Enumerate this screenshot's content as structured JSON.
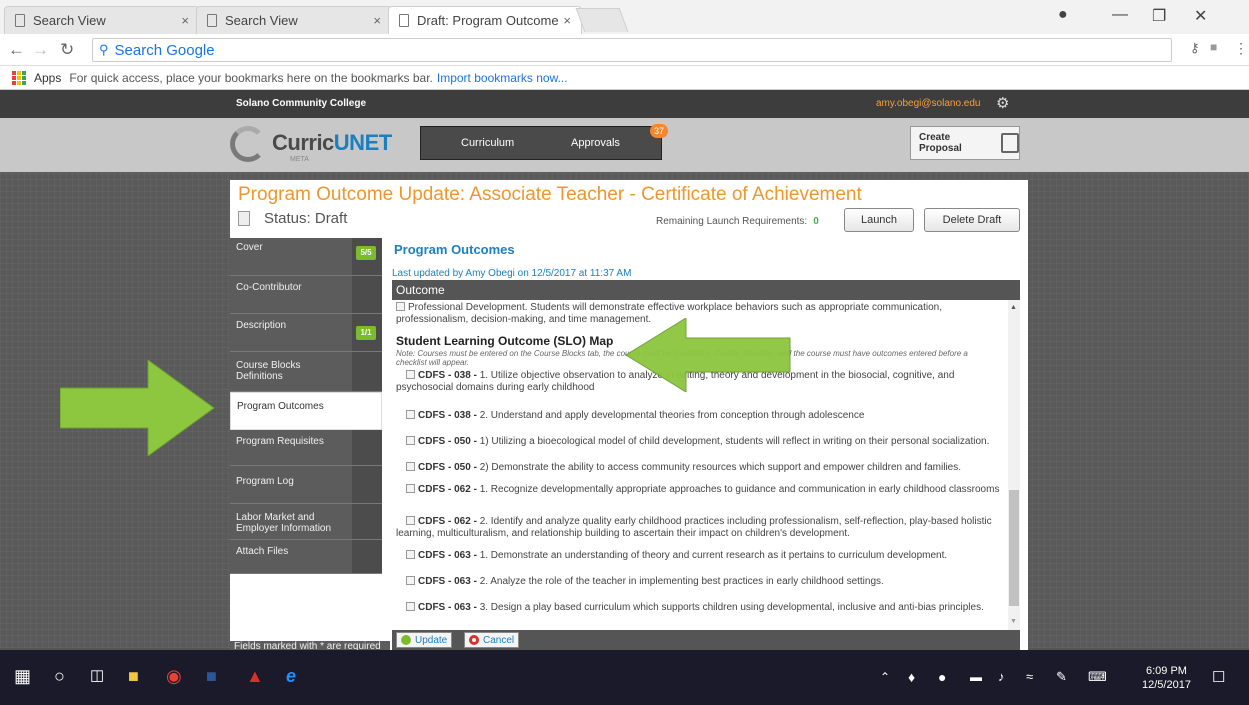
{
  "browser": {
    "tabs": [
      {
        "label": "Search View",
        "close": "×"
      },
      {
        "label": "Search View",
        "close": "×"
      },
      {
        "label": "Draft: Program Outcome",
        "close": "×"
      }
    ],
    "omnibox_text": "Search Google",
    "bookmarks_bar": {
      "apps_label": "Apps",
      "hint": "For quick access, place your bookmarks here on the bookmarks bar.",
      "import_link": "Import bookmarks now..."
    }
  },
  "site": {
    "college": "Solano Community College",
    "user_email": "amy.obegi@solano.edu",
    "logo_prefix": "Curric",
    "logo_suffix": "UNET",
    "logo_sub": "META",
    "nav": {
      "curriculum": "Curriculum",
      "approvals": "Approvals",
      "approvals_badge": "37"
    },
    "create_proposal": "Create Proposal"
  },
  "proposal": {
    "title": "Program Outcome Update: Associate Teacher - Certificate of Achievement",
    "status": "Status: Draft",
    "remaining_label": "Remaining Launch Requirements:",
    "remaining_count": "0",
    "launch_label": "Launch",
    "delete_label": "Delete Draft"
  },
  "sidebar": {
    "items": [
      {
        "label": "Cover",
        "badge": "5/5"
      },
      {
        "label": "Co-Contributor",
        "badge": ""
      },
      {
        "label": "Description",
        "badge": "1/1"
      },
      {
        "label": "Course Blocks Definitions",
        "badge": ""
      },
      {
        "label": "Program Outcomes",
        "badge": ""
      },
      {
        "label": "Program Requisites",
        "badge": ""
      },
      {
        "label": "Program Log",
        "badge": ""
      },
      {
        "label": "Labor Market and Employer Information",
        "badge": ""
      },
      {
        "label": "Attach Files",
        "badge": ""
      }
    ],
    "fields_required": "Fields marked with * are required"
  },
  "content": {
    "section_title": "Program Outcomes",
    "last_updated": "Last updated by Amy Obegi on 12/5/2017 at 11:37 AM",
    "outcome_header": "Outcome",
    "professional_dev": "Professional Development. Students will demonstrate effective workplace behaviors such as appropriate communication, professionalism, decision-making, and time management.",
    "slo_heading": "Student Learning Outcome (SLO) Map",
    "slo_note": "Note: Courses must be entered on the Course Blocks tab, the course must be checked in Course selection, and the course must have outcomes entered before a checklist will appear.",
    "outcomes": [
      {
        "code": "CDFS - 038 -",
        "text": "1. Utilize objective observation to analyze in writing, theory and development in the biosocial, cognitive, and psychosocial domains during early childhood"
      },
      {
        "code": "CDFS - 038 -",
        "text": "2. Understand and apply developmental theories from conception through adolescence"
      },
      {
        "code": "CDFS - 050 -",
        "text": "1) Utilizing a bioecological model of child development, students will reflect in writing on their personal socialization."
      },
      {
        "code": "CDFS - 050 -",
        "text": "2) Demonstrate the ability to access community resources which support and empower children and families."
      },
      {
        "code": "CDFS - 062 -",
        "text": "1. Recognize developmentally appropriate approaches to guidance and communication in early childhood classrooms"
      },
      {
        "code": "CDFS - 062 -",
        "text": "2. Identify and analyze quality early childhood practices including professionalism, self-reflection, play-based holistic learning, multiculturalism, and relationship building to ascertain their impact on children's development."
      },
      {
        "code": "CDFS - 063 -",
        "text": "1. Demonstrate an understanding of theory and current research as it pertains to curriculum development."
      },
      {
        "code": "CDFS - 063 -",
        "text": "2. Analyze the role of the teacher in implementing best practices in early childhood settings."
      },
      {
        "code": "CDFS - 063 -",
        "text": "3. Design a play based curriculum which supports children using developmental, inclusive and anti-bias principles."
      }
    ],
    "update_label": "Update",
    "cancel_label": "Cancel"
  },
  "taskbar": {
    "time": "6:09 PM",
    "date": "12/5/2017"
  },
  "colors": {
    "accent_orange": "#f0962c",
    "link_blue": "#1b7fc0",
    "annotation_green": "#8dc63f"
  }
}
